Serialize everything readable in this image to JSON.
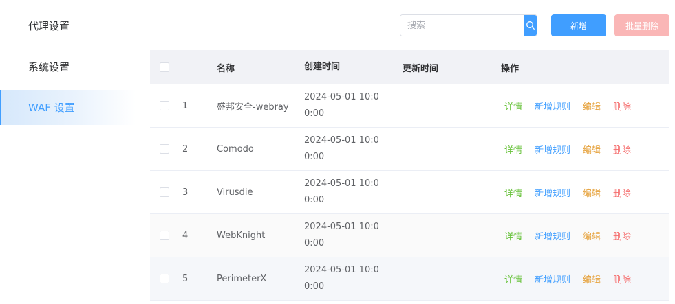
{
  "sidebar": {
    "items": [
      {
        "label": "代理设置"
      },
      {
        "label": "系统设置"
      },
      {
        "label": "WAF 设置"
      }
    ]
  },
  "toolbar": {
    "search_placeholder": "搜索",
    "add_label": "新增",
    "batch_delete_label": "批量删除"
  },
  "table": {
    "headers": {
      "name": "名称",
      "created": "创建时间",
      "updated": "更新时间",
      "ops": "操作"
    },
    "rows": [
      {
        "idx": "1",
        "name": "盛邦安全-webray",
        "created": "2024-05-01 10:00:00",
        "updated": ""
      },
      {
        "idx": "2",
        "name": "Comodo",
        "created": "2024-05-01 10:00:00",
        "updated": ""
      },
      {
        "idx": "3",
        "name": "Virusdie",
        "created": "2024-05-01 10:00:00",
        "updated": ""
      },
      {
        "idx": "4",
        "name": "WebKnight",
        "created": "2024-05-01 10:00:00",
        "updated": ""
      },
      {
        "idx": "5",
        "name": "PerimeterX",
        "created": "2024-05-01 10:00:00",
        "updated": ""
      }
    ],
    "ops": {
      "detail": "详情",
      "add_rule": "新增规则",
      "edit": "编辑",
      "delete": "删除"
    }
  },
  "colors": {
    "primary": "#409eff",
    "success": "#67c23a",
    "warning": "#e6a23c",
    "danger": "#f56c6c",
    "danger_disabled": "#fab6b6"
  }
}
